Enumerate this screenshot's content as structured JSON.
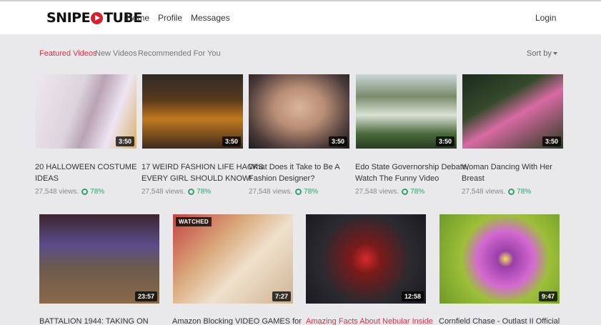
{
  "header": {
    "logo_left": "SNIPE",
    "logo_right": "TUBE",
    "nav": [
      "Home",
      "Profile",
      "Messages"
    ],
    "login": "Login"
  },
  "tabs": [
    {
      "label": "Featured Videos",
      "active": true
    },
    {
      "label": "New Videos",
      "active": false
    },
    {
      "label": "Recommended For You",
      "active": false
    }
  ],
  "sort_label": "Sort by",
  "row1": [
    {
      "title_l1": "20 HALLOWEEN COSTUME",
      "title_l2": "IDEAS",
      "views": "27,548 views.",
      "rating": "78%",
      "duration": "3:50"
    },
    {
      "title_l1": "17 WEIRD FASHION LIFE HACKS",
      "title_l2": "EVERY GIRL SHOULD KNOW!",
      "views": "27,548 views.",
      "rating": "78%",
      "duration": "3:50"
    },
    {
      "title_l1": "What Does it Take to Be A",
      "title_l2": "Fashion Designer?",
      "views": "27,548 views.",
      "rating": "78%",
      "duration": "3:50"
    },
    {
      "title_l1": "Edo State Governorship Debate,",
      "title_l2": "Watch The Funny Video",
      "views": "27,548 views.",
      "rating": "78%",
      "duration": "3:50"
    },
    {
      "title_l1": "Woman Dancing With Her",
      "title_l2": "Breast",
      "views": "27,548 views.",
      "rating": "78%",
      "duration": "3:50"
    }
  ],
  "row2": [
    {
      "title": "BATTALION 1944: TAKING ON",
      "duration": "23:57",
      "watched": ""
    },
    {
      "title": "Amazon Blocking VIDEO GAMES for",
      "duration": "7:27",
      "watched": "WATCHED"
    },
    {
      "title": "Amazing Facts About Nebular Inside",
      "duration": "12:58",
      "watched": ""
    },
    {
      "title": "Cornfield Chase - Outlast II Official",
      "duration": "9:47",
      "watched": ""
    }
  ],
  "colors": {
    "accent": "#d9344a",
    "rating": "#2ea36f",
    "logo_red": "#d8212f"
  }
}
